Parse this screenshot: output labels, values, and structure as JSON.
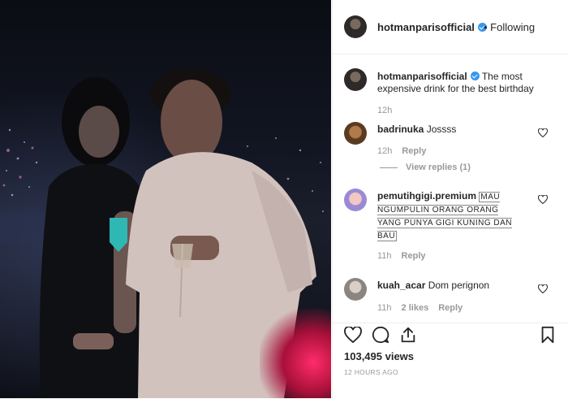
{
  "post": {
    "username": "hotmanparisofficial",
    "follow_status": "• Following",
    "caption_text": "The most expensive drink for the best birthday",
    "caption_time": "12h",
    "views": "103,495 views",
    "posted_ago": "12 HOURS AGO"
  },
  "comments": [
    {
      "username": "badrinuka",
      "text": "Jossss",
      "time": "12h",
      "reply_label": "Reply",
      "view_replies": "View replies (1)"
    },
    {
      "username": "pemutihgigi.premium",
      "text": "MAU NGUMPULIN ORANG ORANG YANG PUNYA GIGI KUNING DAN BAU",
      "time": "11h",
      "reply_label": "Reply"
    },
    {
      "username": "kuah_acar",
      "text": "Dom perignon",
      "time": "11h",
      "likes": "2 likes",
      "reply_label": "Reply"
    }
  ],
  "icons": {
    "like": "heart-icon",
    "comment": "comment-icon",
    "share": "share-icon",
    "save": "bookmark-icon",
    "verified": "verified-badge-icon"
  },
  "colors": {
    "verified": "#3897f0",
    "text": "#262626",
    "muted": "#999999"
  }
}
